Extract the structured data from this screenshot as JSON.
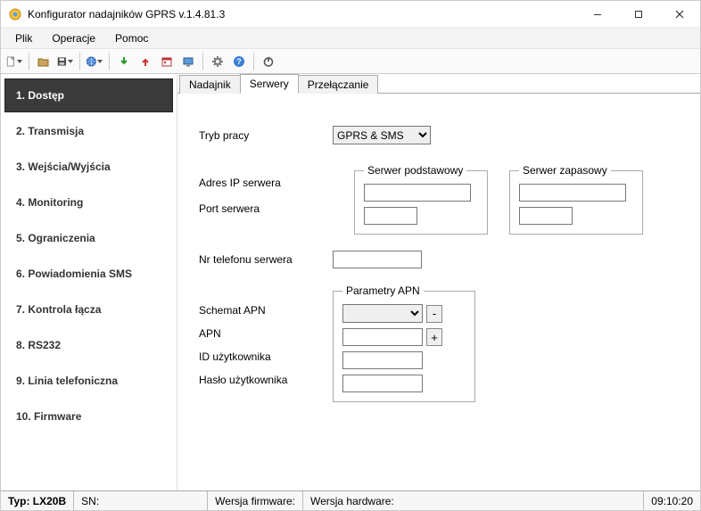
{
  "window": {
    "title": "Konfigurator nadajników GPRS v.1.4.81.3"
  },
  "menu": {
    "file": "Plik",
    "operations": "Operacje",
    "help": "Pomoc"
  },
  "sidebar": {
    "items": [
      {
        "label": "1. Dostęp"
      },
      {
        "label": "2. Transmisja"
      },
      {
        "label": "3. Wejścia/Wyjścia"
      },
      {
        "label": "4. Monitoring"
      },
      {
        "label": "5. Ograniczenia"
      },
      {
        "label": "6. Powiadomienia SMS"
      },
      {
        "label": "7. Kontrola łącza"
      },
      {
        "label": "8. RS232"
      },
      {
        "label": "9. Linia telefoniczna"
      },
      {
        "label": "10. Firmware"
      }
    ],
    "active_index": 0
  },
  "tabs": {
    "items": [
      {
        "label": "Nadajnik"
      },
      {
        "label": "Serwery"
      },
      {
        "label": "Przełączanie"
      }
    ],
    "active_index": 1
  },
  "form": {
    "mode_label": "Tryb pracy",
    "mode_value": "GPRS & SMS",
    "primary_server_legend": "Serwer podstawowy",
    "backup_server_legend": "Serwer zapasowy",
    "server_ip_label": "Adres IP serwera",
    "server_port_label": "Port serwera",
    "primary_ip": "",
    "primary_port": "",
    "backup_ip": "",
    "backup_port": "",
    "server_phone_label": "Nr telefonu serwera",
    "server_phone": "",
    "apn_legend": "Parametry APN",
    "apn_scheme_label": "Schemat APN",
    "apn_scheme_value": "",
    "apn_label": "APN",
    "apn_value": "",
    "apn_user_label": "ID użytkownika",
    "apn_user_value": "",
    "apn_pass_label": "Hasło użytkownika",
    "apn_pass_value": "",
    "minus_label": "-",
    "plus_label": "+"
  },
  "status": {
    "type_label": "Typ:",
    "type_value": "LX20B",
    "sn_label": "SN:",
    "fw_label": "Wersja firmware:",
    "hw_label": "Wersja hardware:",
    "clock": "09:10:20"
  }
}
